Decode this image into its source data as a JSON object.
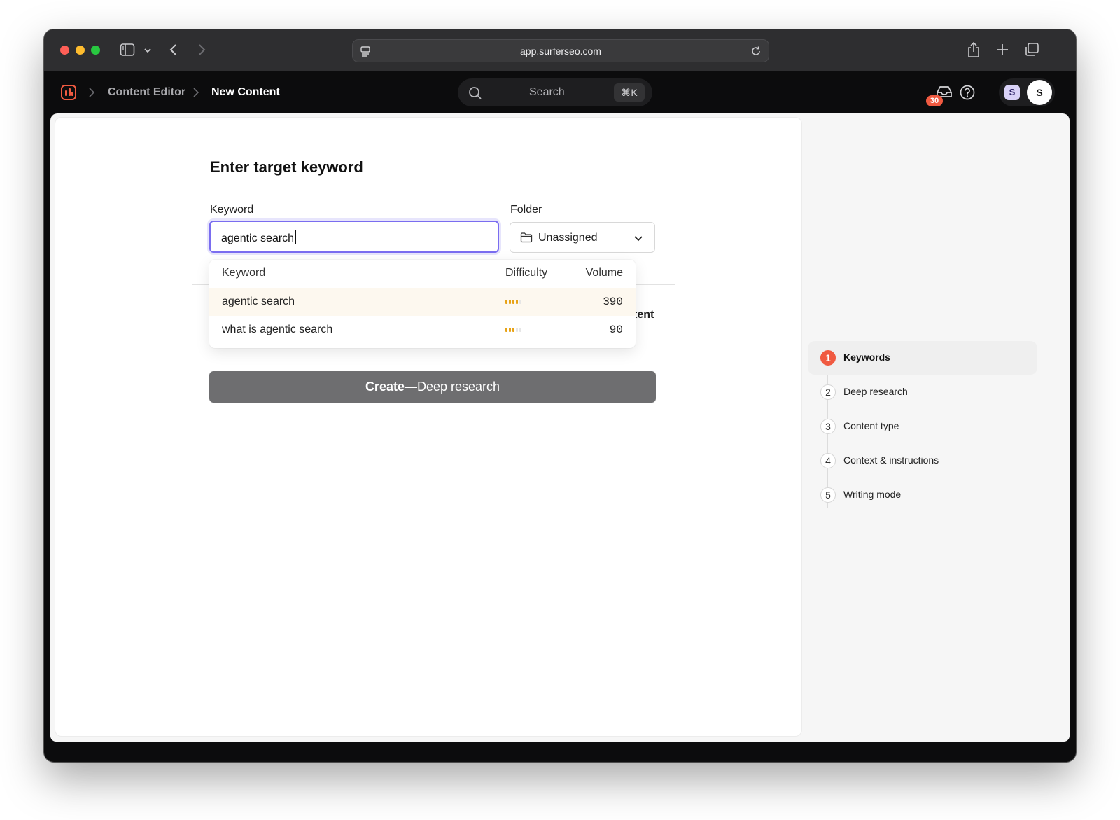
{
  "browser": {
    "url": "app.surferseo.com"
  },
  "app": {
    "breadcrumb": [
      "Content Editor",
      "New Content"
    ],
    "search": {
      "placeholder": "Search",
      "shortcut": "⌘K"
    },
    "notifications_count": "30",
    "workspace_initial": "S",
    "user_initial": "S"
  },
  "form": {
    "title": "Enter target keyword",
    "keyword_label": "Keyword",
    "keyword_value": "agentic search",
    "folder_label": "Folder",
    "folder_value": "Unassigned",
    "partial_text": "tent",
    "create_button": {
      "bold": "Create",
      "rest": "—Deep research"
    }
  },
  "suggestions": {
    "headers": {
      "keyword": "Keyword",
      "difficulty": "Difficulty",
      "volume": "Volume"
    },
    "rows": [
      {
        "keyword": "agentic search",
        "difficulty_level": 0.8,
        "volume": "390"
      },
      {
        "keyword": "what is agentic search",
        "difficulty_level": 0.6,
        "volume": "90"
      }
    ]
  },
  "steps": [
    {
      "number": "1",
      "label": "Keywords",
      "active": true
    },
    {
      "number": "2",
      "label": "Deep research",
      "active": false
    },
    {
      "number": "3",
      "label": "Content type",
      "active": false
    },
    {
      "number": "4",
      "label": "Context & instructions",
      "active": false
    },
    {
      "number": "5",
      "label": "Writing mode",
      "active": false
    }
  ],
  "colors": {
    "accent": "#f05a41",
    "focus": "#7a6df0",
    "difficulty": "#e8a317"
  }
}
